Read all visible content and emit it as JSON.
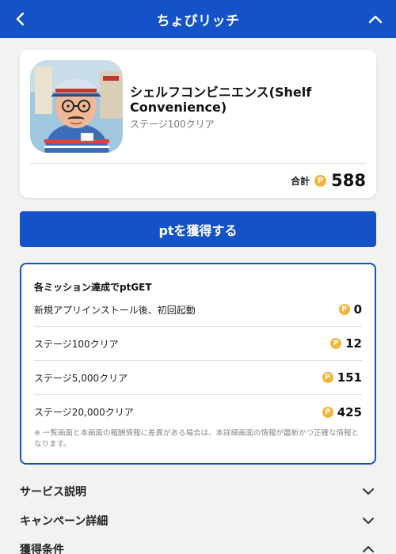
{
  "header": {
    "title": "ちょびリッチ"
  },
  "app": {
    "name": "シェルフコンビニエンス(Shelf Convenience)",
    "subtitle": "ステージ100クリア",
    "total_label": "合計",
    "total_points": "588"
  },
  "coin_symbol": "P",
  "cta_label": "ptを獲得する",
  "missions": {
    "heading": "各ミッション達成でptGET",
    "items": [
      {
        "label": "新規アプリインストール後、初回起動",
        "points": "0"
      },
      {
        "label": "ステージ100クリア",
        "points": "12"
      },
      {
        "label": "ステージ5,000クリア",
        "points": "151"
      },
      {
        "label": "ステージ20,000クリア",
        "points": "425"
      }
    ],
    "note": "※ 一覧画面と本画面の報酬情報に差異がある場合は、本詳細画面の情報が最新かつ正確な情報となります。"
  },
  "accordions": [
    {
      "label": "サービス説明",
      "state": "collapsed"
    },
    {
      "label": "キャンペーン詳細",
      "state": "collapsed"
    },
    {
      "label": "獲得条件",
      "state": "expanded"
    }
  ],
  "colors": {
    "primary": "#1452c8",
    "coin": "#f5b43c",
    "background": "#f2f2f2"
  }
}
